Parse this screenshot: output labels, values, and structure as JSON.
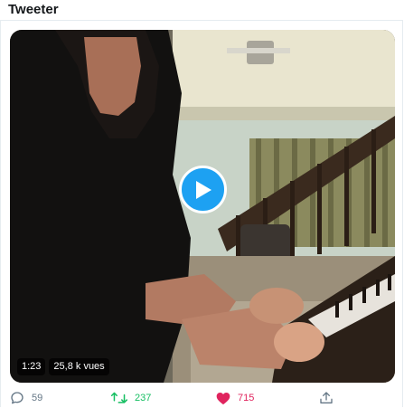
{
  "header": {
    "title": "Tweeter"
  },
  "video": {
    "duration": "1:23",
    "views": "25,8 k vues",
    "icons": {
      "play": "play-icon"
    }
  },
  "actions": {
    "reply": {
      "icon": "reply-icon",
      "count": "59"
    },
    "retweet": {
      "icon": "retweet-icon",
      "count": "237",
      "color": "#17bf63"
    },
    "like": {
      "icon": "heart-icon",
      "count": "715",
      "color": "#e0245e"
    },
    "share": {
      "icon": "share-icon"
    }
  },
  "colors": {
    "accent": "#1da1f2",
    "text": "#14171a",
    "muted": "#657786"
  }
}
